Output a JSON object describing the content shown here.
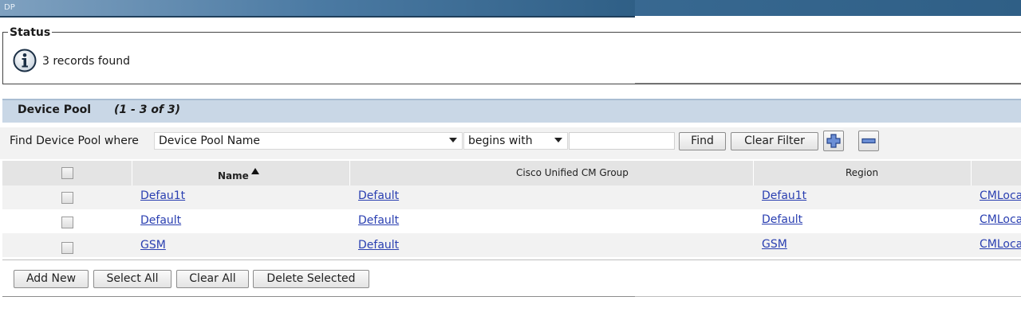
{
  "window": {
    "title": "DP"
  },
  "status": {
    "legend": "Status",
    "icon": "info-icon",
    "message": "3 records found"
  },
  "section": {
    "title": "Device Pool",
    "count": "(1 - 3 of 3)"
  },
  "find": {
    "label": "Find Device Pool where",
    "field_selected": "Device Pool Name",
    "operator_selected": "begins with",
    "search_value": "",
    "find_label": "Find",
    "clear_filter_label": "Clear Filter",
    "add_criteria_icon": "plus-icon",
    "remove_criteria_icon": "minus-icon"
  },
  "table": {
    "columns": [
      "Name",
      "Cisco Unified CM Group",
      "Region",
      "CMLoca"
    ],
    "sort_icon": "sort-ascending-icon",
    "rows": [
      {
        "name": "Defau1t",
        "cm_group": "Default",
        "region": "Defau1t",
        "location": "CMLoca"
      },
      {
        "name": "Default",
        "cm_group": "Default",
        "region": "Default",
        "location": "CMLoca"
      },
      {
        "name": "GSM",
        "cm_group": "Default",
        "region": "GSM",
        "location": "CMLoca"
      }
    ]
  },
  "actions": {
    "add_new": "Add New",
    "select_all": "Select All",
    "clear_all": "Clear All",
    "delete_selected": "Delete Selected"
  },
  "colors": {
    "link": "#2a3fb1",
    "section_header": "#c9d7e6",
    "topbar": "#2f5f86"
  }
}
